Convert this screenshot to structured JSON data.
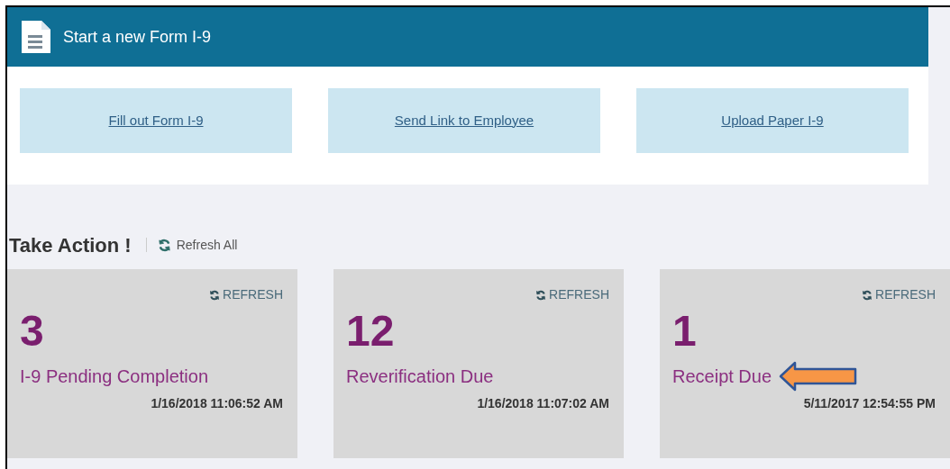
{
  "header": {
    "title": "Start a new Form I-9"
  },
  "start_links": [
    "Fill out Form I-9",
    "Send Link to Employee",
    "Upload Paper I-9"
  ],
  "take_action": {
    "title": "Take Action !",
    "refresh_all": "Refresh All"
  },
  "cards": [
    {
      "refresh": "REFRESH",
      "count": "3",
      "label": "I-9 Pending Completion",
      "timestamp": "1/16/2018 11:06:52 AM",
      "highlighted": false
    },
    {
      "refresh": "REFRESH",
      "count": "12",
      "label": "Reverification Due",
      "timestamp": "1/16/2018 11:07:02 AM",
      "highlighted": false
    },
    {
      "refresh": "REFRESH",
      "count": "1",
      "label": "Receipt Due",
      "timestamp": "5/11/2017 12:54:55 PM",
      "highlighted": true
    }
  ]
}
